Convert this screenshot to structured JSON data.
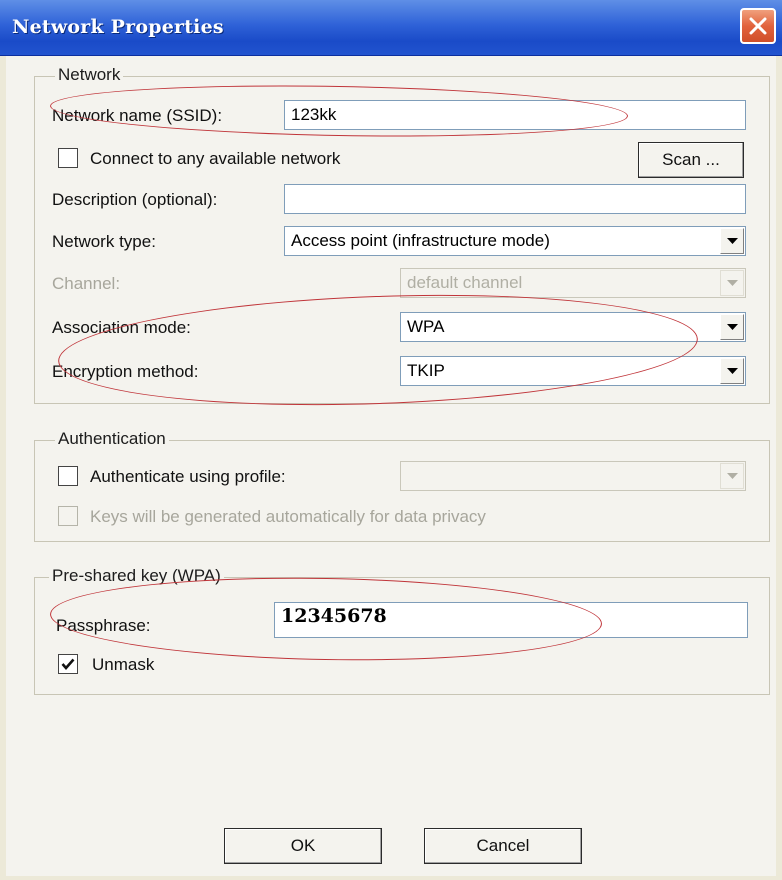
{
  "window": {
    "title": "Network Properties"
  },
  "network_group": {
    "legend": "Network",
    "ssid_label": "Network name (SSID):",
    "ssid_value": "123kk",
    "connect_any_label": "Connect to any available network",
    "connect_any_checked": false,
    "scan_button": "Scan ...",
    "description_label": "Description (optional):",
    "description_value": "",
    "network_type_label": "Network type:",
    "network_type_value": "Access point (infrastructure mode)",
    "channel_label": "Channel:",
    "channel_value": "default channel",
    "association_label": "Association mode:",
    "association_value": "WPA",
    "encryption_label": "Encryption method:",
    "encryption_value": "TKIP"
  },
  "authentication_group": {
    "legend": "Authentication",
    "authenticate_label": "Authenticate using profile:",
    "authenticate_checked": false,
    "profile_value": "",
    "keys_auto_label": "Keys will be generated automatically for data privacy",
    "keys_auto_checked": false
  },
  "psk_group": {
    "legend": "Pre-shared key (WPA)",
    "passphrase_label": "Passphrase:",
    "passphrase_value": "12345678",
    "unmask_label": "Unmask",
    "unmask_checked": true
  },
  "buttons": {
    "ok": "OK",
    "cancel": "Cancel"
  },
  "colors": {
    "title_bar": "#2f62d8",
    "close_button": "#e2633d",
    "annotation_ellipse": "#c0353a"
  }
}
